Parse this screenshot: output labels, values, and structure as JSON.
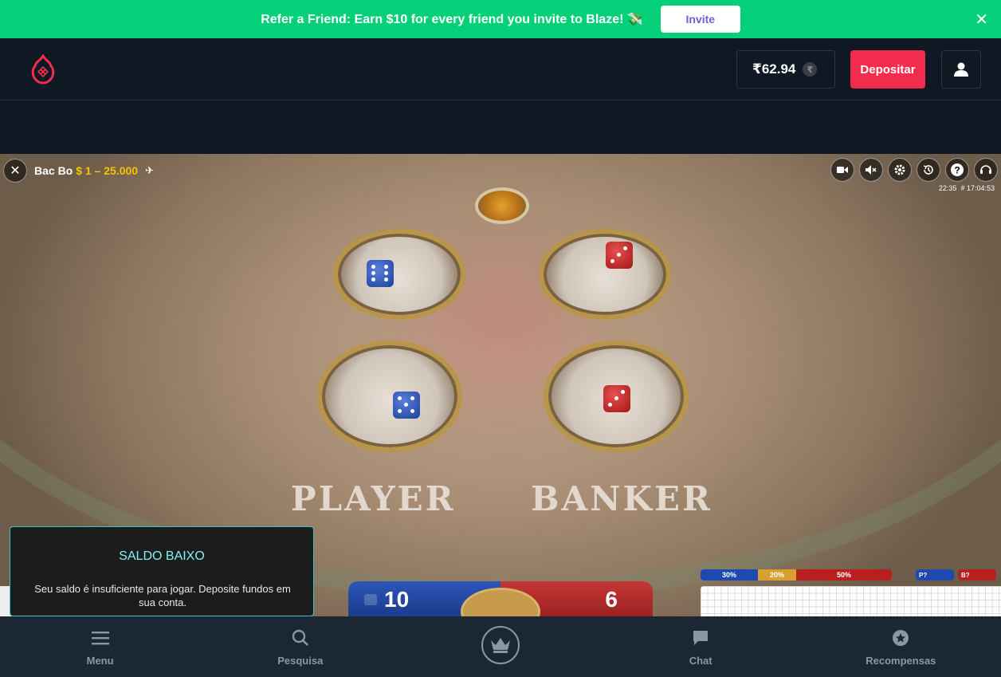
{
  "promo": {
    "text": "Refer a Friend: Earn $10 for every friend you invite to Blaze! 💸",
    "button_label": "Invite",
    "close": "✕"
  },
  "header": {
    "balance": "₹62.94",
    "currency_symbol": "₹",
    "deposit_label": "Depositar"
  },
  "game": {
    "name": "Bac Bo",
    "limits": "$ 1 – 25.000",
    "time": "22:35",
    "round_id": "# 17:04:53",
    "labels": {
      "player": "PLAYER",
      "banker": "BANKER"
    },
    "score_player": "10",
    "score_banker": "6",
    "stats": [
      {
        "label": "30%",
        "color": "#1e4ab0"
      },
      {
        "label": "20%",
        "color": "#d8a030"
      },
      {
        "label": "50%",
        "color": "#b82020"
      }
    ],
    "predict": {
      "player": "P?",
      "banker": "B?"
    },
    "controls": [
      "video-icon",
      "mute-icon",
      "settings-icon",
      "history-icon",
      "help-icon",
      "support-icon"
    ]
  },
  "low_balance": {
    "title": "SALDO BAIXO",
    "message": "Seu saldo é insuficiente para jogar. Deposite fundos em sua conta."
  },
  "nav": {
    "menu": "Menu",
    "search": "Pesquisa",
    "chat": "Chat",
    "rewards": "Recompensas"
  },
  "colors": {
    "promo_bg": "#05d07a",
    "deposit": "#f12c4c",
    "accent_limits": "#f5c300",
    "lowbal_title": "#7ff3f5"
  }
}
